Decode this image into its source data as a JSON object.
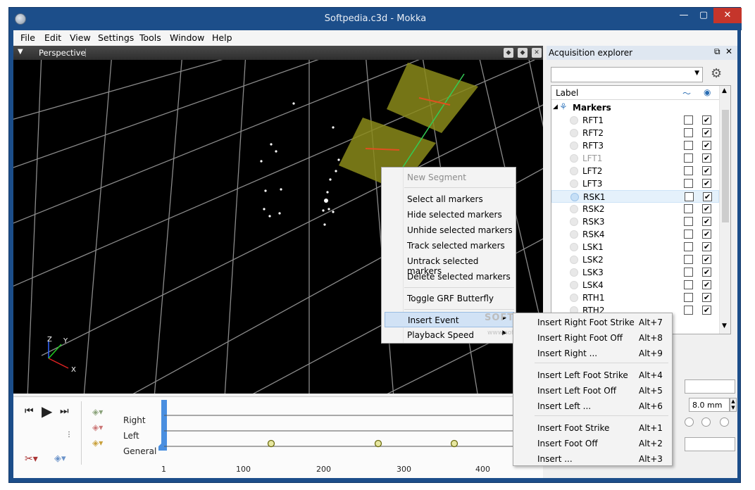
{
  "window": {
    "title": "Softpedia.c3d - Mokka",
    "min": "—",
    "max": "▢",
    "close": "✕"
  },
  "menu": [
    "File",
    "Edit",
    "View",
    "Settings",
    "Tools",
    "Window",
    "Help"
  ],
  "viewport": {
    "label": "Perspective",
    "axis_x": "X",
    "axis_y": "Y",
    "axis_z": "Z"
  },
  "timeline": {
    "rows": [
      "Right",
      "Left",
      "General"
    ],
    "ticks": [
      "1",
      "100",
      "200",
      "300",
      "400"
    ]
  },
  "explorer": {
    "title": "Acquisition explorer",
    "column_label": "Label",
    "group": "Markers",
    "markers": [
      {
        "name": "RFT1",
        "a": false,
        "b": true
      },
      {
        "name": "RFT2",
        "a": false,
        "b": true
      },
      {
        "name": "RFT3",
        "a": false,
        "b": true
      },
      {
        "name": "LFT1",
        "a": false,
        "b": true,
        "hidden": true
      },
      {
        "name": "LFT2",
        "a": false,
        "b": true
      },
      {
        "name": "LFT3",
        "a": false,
        "b": true
      },
      {
        "name": "RSK1",
        "a": false,
        "b": true,
        "selected": true
      },
      {
        "name": "RSK2",
        "a": false,
        "b": true
      },
      {
        "name": "RSK3",
        "a": false,
        "b": true
      },
      {
        "name": "RSK4",
        "a": false,
        "b": true
      },
      {
        "name": "LSK1",
        "a": false,
        "b": true
      },
      {
        "name": "LSK2",
        "a": false,
        "b": true
      },
      {
        "name": "LSK3",
        "a": false,
        "b": true
      },
      {
        "name": "LSK4",
        "a": false,
        "b": true
      },
      {
        "name": "RTH1",
        "a": false,
        "b": true
      },
      {
        "name": "RTH2",
        "a": false,
        "b": true
      }
    ],
    "radius_value": "8.0 mm"
  },
  "context_menu": {
    "new_segment": "New Segment",
    "select_all": "Select all markers",
    "hide_selected": "Hide selected markers",
    "unhide_selected": "Unhide selected markers",
    "track_selected": "Track selected markers",
    "untrack_selected": "Untrack selected markers",
    "delete_selected": "Delete selected markers",
    "toggle_grf": "Toggle GRF Butterfly",
    "insert_event": "Insert Event",
    "playback_speed": "Playback Speed"
  },
  "submenu": [
    {
      "label": "Insert Right Foot Strike",
      "shortcut": "Alt+7"
    },
    {
      "label": "Insert Right Foot Off",
      "shortcut": "Alt+8"
    },
    {
      "label": "Insert Right ...",
      "shortcut": "Alt+9"
    },
    {
      "label": "Insert Left Foot Strike",
      "shortcut": "Alt+4"
    },
    {
      "label": "Insert Left Foot Off",
      "shortcut": "Alt+5"
    },
    {
      "label": "Insert Left ...",
      "shortcut": "Alt+6"
    },
    {
      "label": "Insert Foot Strike",
      "shortcut": "Alt+1"
    },
    {
      "label": "Insert Foot Off",
      "shortcut": "Alt+2"
    },
    {
      "label": "Insert ...",
      "shortcut": "Alt+3"
    }
  ],
  "watermark": "SOFTPEDIA",
  "watermark_url": "www.softpedia.com"
}
